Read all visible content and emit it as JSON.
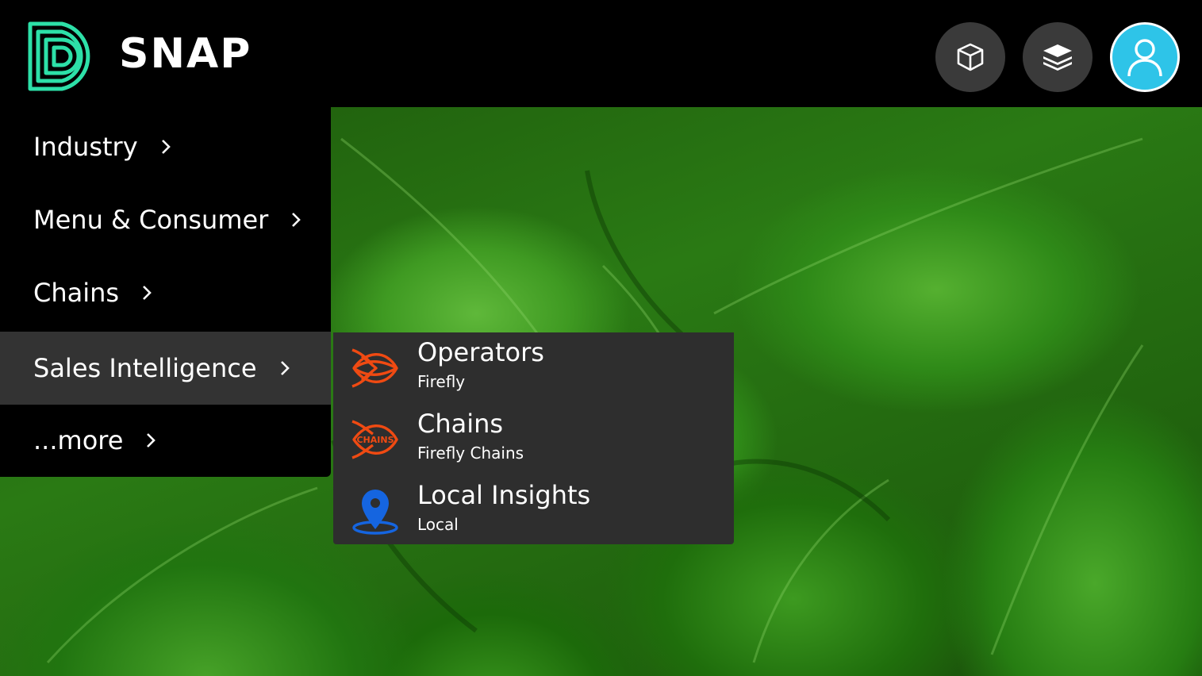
{
  "header": {
    "brand": "SNAP",
    "icons": [
      "cube-icon",
      "layers-icon",
      "user-icon"
    ],
    "colors": {
      "logo": "#2de0a8",
      "user_button": "#2ec4e8",
      "round_button": "#3a3a3a"
    }
  },
  "menu": {
    "items": [
      {
        "label": "Industry"
      },
      {
        "label": "Menu & Consumer"
      },
      {
        "label": "Chains"
      },
      {
        "label": "Sales Intelligence",
        "active": true
      },
      {
        "label": "...more"
      }
    ]
  },
  "submenu": {
    "items": [
      {
        "title": "Operators",
        "caption": "Firefly",
        "icon": "firefly-icon",
        "icon_color": "#f04a12"
      },
      {
        "title": "Chains",
        "caption": "Firefly Chains",
        "icon": "firefly-chains-icon",
        "icon_color": "#f04a12",
        "icon_text": "CHAINS"
      },
      {
        "title": "Local Insights",
        "caption": "Local",
        "icon": "map-pin-icon",
        "icon_color": "#1565e0"
      }
    ]
  }
}
